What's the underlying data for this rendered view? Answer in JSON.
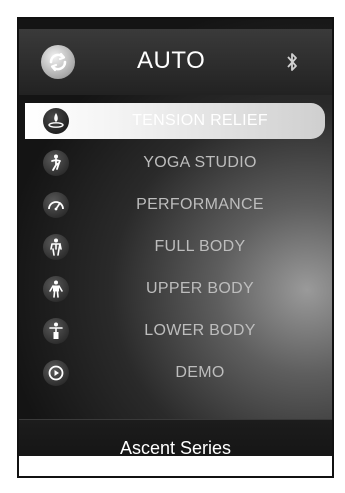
{
  "header": {
    "title": "AUTO",
    "mode_icon": "auto-cycle-icon",
    "status_icon": "bluetooth-icon"
  },
  "menu": {
    "items": [
      {
        "label": "TENSION RELIEF",
        "icon": "water-drop-icon",
        "active": true
      },
      {
        "label": "YOGA STUDIO",
        "icon": "yoga-pose-icon",
        "active": false
      },
      {
        "label": "PERFORMANCE",
        "icon": "speedometer-icon",
        "active": false
      },
      {
        "label": "FULL BODY",
        "icon": "full-body-icon",
        "active": false
      },
      {
        "label": "UPPER BODY",
        "icon": "upper-body-icon",
        "active": false
      },
      {
        "label": "LOWER BODY",
        "icon": "lower-body-icon",
        "active": false
      },
      {
        "label": "DEMO",
        "icon": "play-icon",
        "active": false
      }
    ]
  },
  "footer": {
    "brand": "Ascent Series"
  },
  "colors": {
    "active_highlight": "#ffffff",
    "inactive_text": "#bdbdbd",
    "background": "#1a1a1a"
  }
}
